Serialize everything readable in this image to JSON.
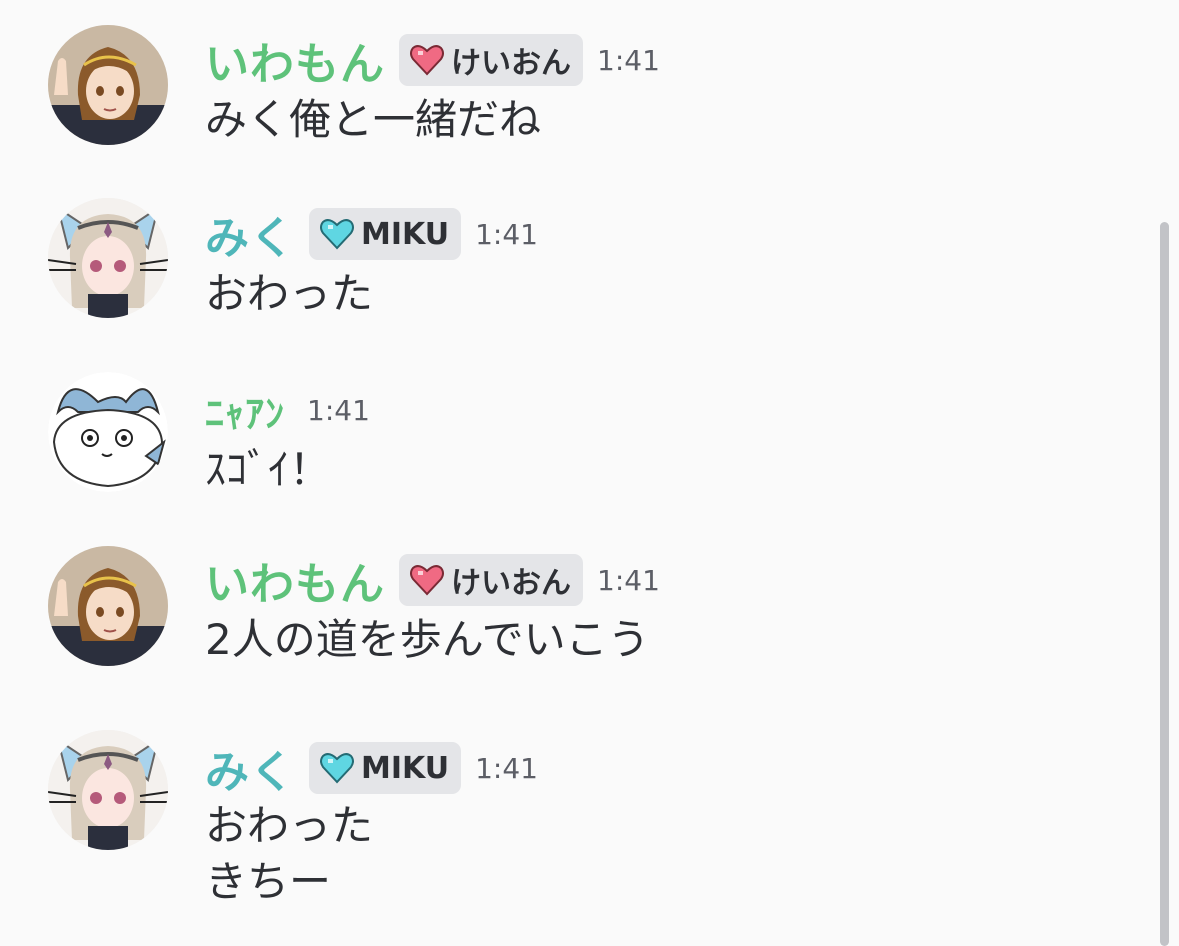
{
  "colors": {
    "green_name": "#5ec27a",
    "teal_name": "#4fb6b9",
    "pink_heart": "#f06a83",
    "blue_heart": "#5fd6e2"
  },
  "messages": [
    {
      "avatar_icon": "brown-hair-anime-avatar",
      "username": "いわもん",
      "tag_icon": "pink-heart-icon",
      "tag_label": "けいおん",
      "time": "1:41",
      "lines": [
        "みく俺と一緒だね"
      ]
    },
    {
      "avatar_icon": "cat-ear-anime-avatar",
      "username": "みく",
      "tag_icon": "blue-heart-icon",
      "tag_label": "MIKU",
      "time": "1:41",
      "lines": [
        "おわった"
      ]
    },
    {
      "avatar_icon": "white-cat-avatar",
      "username": "ﾆｬｱﾝ",
      "time": "1:41",
      "lines": [
        "ｽｺﾞｲ！"
      ]
    },
    {
      "avatar_icon": "brown-hair-anime-avatar",
      "username": "いわもん",
      "tag_icon": "pink-heart-icon",
      "tag_label": "けいおん",
      "time": "1:41",
      "lines": [
        "2人の道を歩んでいこう"
      ]
    },
    {
      "avatar_icon": "cat-ear-anime-avatar",
      "username": "みく",
      "tag_icon": "blue-heart-icon",
      "tag_label": "MIKU",
      "time": "1:41",
      "lines": [
        "おわった",
        "きちー"
      ]
    }
  ]
}
